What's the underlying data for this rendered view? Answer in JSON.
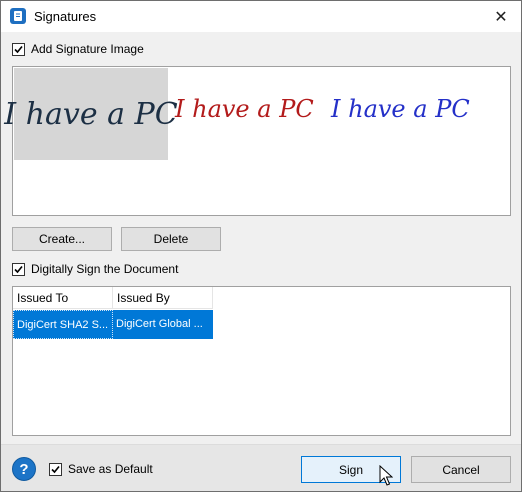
{
  "window": {
    "title": "Signatures",
    "close_glyph": "✕"
  },
  "signature_image": {
    "checkbox_label": "Add Signature Image",
    "checked": true,
    "signatures": [
      {
        "text": "I have a PC",
        "color": "#1c2f44",
        "selected": true
      },
      {
        "text": "I have a PC",
        "color": "#b31b1b",
        "selected": false
      },
      {
        "text": "I have a PC",
        "color": "#2430c8",
        "selected": false
      }
    ],
    "create_label": "Create...",
    "delete_label": "Delete"
  },
  "digital_sign": {
    "checkbox_label": "Digitally Sign the Document",
    "checked": true,
    "columns": [
      "Issued To",
      "Issued By"
    ],
    "rows": [
      {
        "issued_to": "DigiCert SHA2 S...",
        "issued_by": "DigiCert Global ...",
        "selected": true
      }
    ]
  },
  "footer": {
    "help_glyph": "?",
    "save_default_label": "Save as Default",
    "save_default_checked": true,
    "sign_label": "Sign",
    "cancel_label": "Cancel"
  },
  "colors": {
    "accent": "#0078d7",
    "dialog_bg": "#f0f0f0",
    "help_icon": "#1c74c7"
  },
  "icons": [
    "app-icon",
    "close-icon",
    "checkbox-check-icon",
    "help-icon",
    "mouse-pointer-icon"
  ]
}
